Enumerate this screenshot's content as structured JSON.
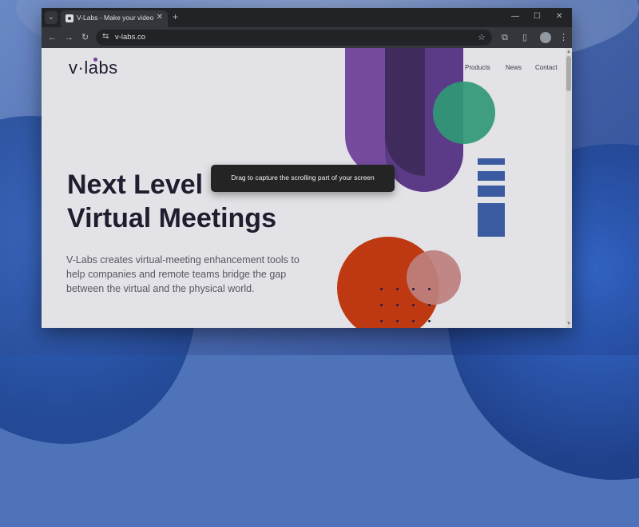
{
  "browser": {
    "tab_title": "V-Labs - Make your video mee",
    "new_tab_icon": "+",
    "url": "v-labs.co",
    "icons": [
      "back-arrow-icon",
      "forward-arrow-icon",
      "reload-icon",
      "site-info-icon",
      "star-icon",
      "extensions-icon",
      "sidebar-icon",
      "profile-avatar",
      "more-menu-icon"
    ]
  },
  "page": {
    "logo": "v·labs",
    "nav": [
      "Products",
      "News",
      "Contact"
    ],
    "hero_title_line1": "Next Level",
    "hero_title_line2": "Virtual Meetings",
    "hero_text": "V-Labs creates virtual-meeting enhancement tools to help companies and remote teams bridge the gap between the virtual and the physical world."
  },
  "overlay": {
    "toast_text": "Drag to capture the scrolling part of your screen"
  },
  "colors": {
    "purple_light": "#7b4da6",
    "purple_mid": "#5e3b8c",
    "purple_dark": "#3f2a5e",
    "teal": "#2fa17b",
    "blue_bars": "#3a5ea6",
    "orange": "#c9390c",
    "pink": "#c98583"
  }
}
